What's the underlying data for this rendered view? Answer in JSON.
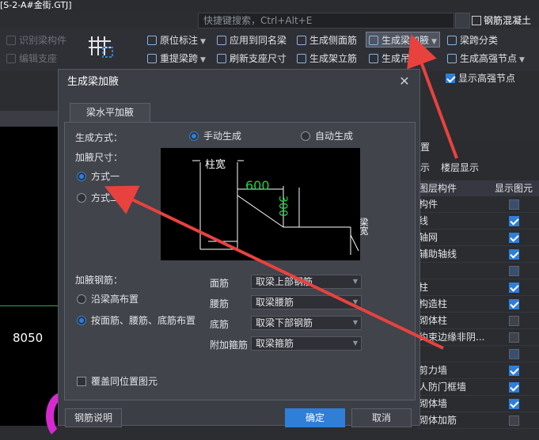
{
  "window": {
    "title": "[S-2-A#金街.GTJ]"
  },
  "search": {
    "placeholder": "快捷键搜索，Ctrl+Alt+E"
  },
  "app_title": "钢筋混凝土",
  "ribbon": {
    "identify_beam": "识别梁构件",
    "edit_support": "编辑支座",
    "origin_mark": "原位标注",
    "apply_same_beam": "应用到同名梁",
    "gen_side_rebar": "生成侧面筋",
    "gen_haunch": "生成梁加腋",
    "span_classify": "梁跨分类",
    "re_extract_span": "重提梁跨",
    "refresh_support": "刷新支座尺寸",
    "gen_stand_rebar": "生成架立筋",
    "gen_hanger": "生成吊筋",
    "gen_high_node": "生成高强节点",
    "show_high_node": "显示高强节点"
  },
  "canvas": {
    "dimension_text": "8050"
  },
  "right_panel": {
    "header": "置",
    "tabs": [
      "示",
      "楼层显示"
    ],
    "col_component": "图层构件",
    "col_display": "显示图元",
    "rows": [
      {
        "label": "构件",
        "checked": "partial"
      },
      {
        "label": "线",
        "checked": "on"
      },
      {
        "label": "轴网",
        "checked": "on"
      },
      {
        "label": "辅助轴线",
        "checked": "on"
      },
      {
        "label": "",
        "checked": "partial"
      },
      {
        "label": "柱",
        "checked": "on"
      },
      {
        "label": "构造柱",
        "checked": "on"
      },
      {
        "label": "砌体柱",
        "checked": "off"
      },
      {
        "label": "约束边缘非阴...",
        "checked": "off"
      },
      {
        "label": "",
        "checked": "partial"
      },
      {
        "label": "剪力墙",
        "checked": "on"
      },
      {
        "label": "人防门框墙",
        "checked": "on"
      },
      {
        "label": "砌体墙",
        "checked": "on"
      },
      {
        "label": "砌体加筋",
        "checked": "off"
      }
    ]
  },
  "dialog": {
    "title": "生成梁加腋",
    "tab": "梁水平加腋",
    "gen_method_label": "生成方式：",
    "manual": "手动生成",
    "auto": "自动生成",
    "size_label": "加腋尺寸：",
    "method1": "方式一",
    "method2": "方式二",
    "preview": {
      "col_width": "柱宽",
      "dim_600": "600",
      "dim_300": "300",
      "beam_width": "梁宽"
    },
    "rebar_label": "加腋钢筋：",
    "along_height": "沿梁高布置",
    "by_face": "按面筋、腰筋、底筋布置",
    "face_rebar_label": "面筋",
    "face_rebar_value": "取梁上部钢筋",
    "waist_rebar_label": "腰筋",
    "waist_rebar_value": "取梁腰筋",
    "bottom_rebar_label": "底筋",
    "bottom_rebar_value": "取梁下部钢筋",
    "stirrup_label": "附加箍筋",
    "stirrup_value": "取梁箍筋",
    "overwrite": "覆盖同位置图元",
    "help_btn": "钢筋说明",
    "ok_btn": "确定",
    "cancel_btn": "取消"
  },
  "colors": {
    "accent": "#2f7fd8",
    "arrow": "#e8423f",
    "dim_green": "#23d14a"
  }
}
